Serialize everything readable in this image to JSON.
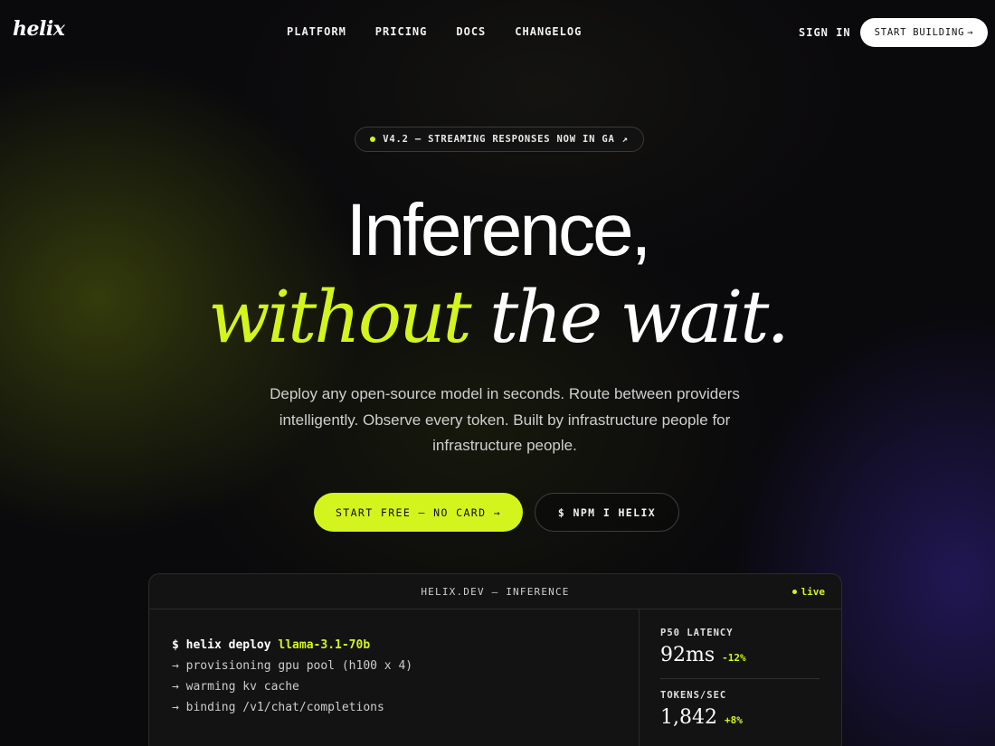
{
  "nav": {
    "logo": "helix",
    "links": [
      "PLATFORM",
      "PRICING",
      "DOCS",
      "CHANGELOG"
    ],
    "sign_in": "SIGN IN",
    "start_building": "START BUILDING",
    "arrow": "→"
  },
  "badge": {
    "text": "V4.2 — STREAMING RESPONSES NOW IN GA",
    "arrow": "↗"
  },
  "hero": {
    "line1": "Inference,",
    "line2_accent": "without",
    "line2_rest": " the wait.",
    "subtitle": "Deploy any open-source model in seconds. Route between providers intelligently. Observe every token. Built by infrastructure people for infrastructure people."
  },
  "cta": {
    "primary": "START FREE — NO CARD →",
    "secondary": "$ NPM I HELIX"
  },
  "terminal": {
    "title": "HELIX.DEV — INFERENCE",
    "status": "live",
    "prompt": "$ helix deploy ",
    "model": "llama-3.1-70b",
    "lines": [
      "→ provisioning gpu pool (h100 x 4)",
      "→ warming kv cache",
      "→ binding /v1/chat/completions"
    ],
    "stats": [
      {
        "label": "P50 LATENCY",
        "value": "92ms",
        "delta": "-12%"
      },
      {
        "label": "TOKENS/SEC",
        "value": "1,842",
        "delta": "+8%"
      }
    ]
  },
  "colors": {
    "accent": "#d4f41d",
    "background": "#0a090c"
  }
}
